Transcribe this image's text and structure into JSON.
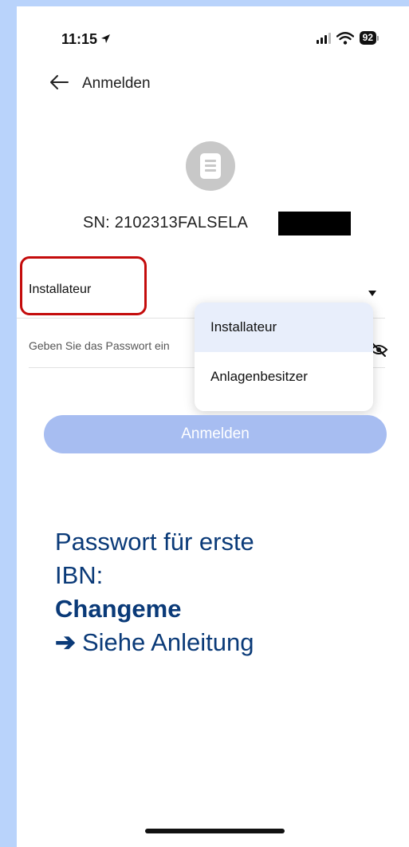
{
  "status": {
    "time": "11:15",
    "battery": "92",
    "icons": [
      "location-arrow-icon",
      "signal-icon",
      "wifi-icon",
      "battery-icon"
    ]
  },
  "header": {
    "title": "Anmelden",
    "back_icon": "arrow-left-icon"
  },
  "device": {
    "icon": "document-icon",
    "sn_label": "SN:",
    "sn_value": "2102313FALSELA"
  },
  "role_select": {
    "value": "Installateur"
  },
  "password": {
    "placeholder": "Geben Sie das Passwort ein",
    "icon": "eye-off-icon"
  },
  "dropdown": {
    "options": [
      "Installateur",
      "Anlagenbesitzer"
    ],
    "selected": "Installateur"
  },
  "login_button": {
    "label": "Anmelden"
  },
  "instructions": {
    "line1": "Passwort für erste",
    "line2": "IBN:",
    "line3": "Changeme",
    "arrow": "➔",
    "line4": "Siehe Anleitung"
  },
  "colors": {
    "background": "#b9d3fb",
    "highlight": "#c40c0c",
    "button": "#a7bdf1",
    "instruction_text": "#0a3a78",
    "dropdown_selected": "#e8eefb"
  }
}
